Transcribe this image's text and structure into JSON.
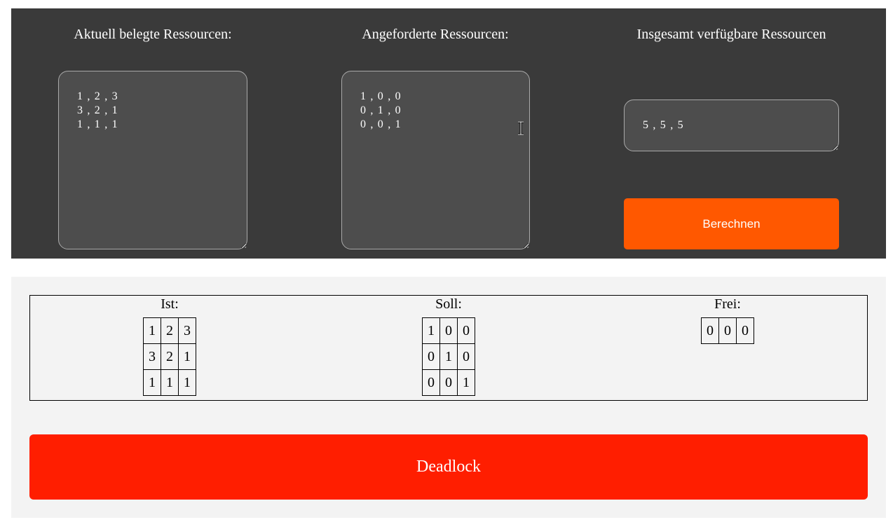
{
  "input_panel": {
    "allocated": {
      "title": "Aktuell belegte Ressourcen:",
      "value": "1 , 2 , 3\n3 , 2 , 1\n1 , 1 , 1"
    },
    "requested": {
      "title": "Angeforderte Ressourcen:",
      "value": "1 , 0 , 0\n0 , 1 , 0\n0 , 0 , 1"
    },
    "available": {
      "title": "Insgesamt verfügbare Ressourcen",
      "value": "5 , 5 , 5"
    },
    "calculate_label": "Berechnen",
    "colors": {
      "panel_bg": "#3a3a3a",
      "field_bg": "#4d4d4d",
      "button_bg": "#ff5800"
    }
  },
  "results": {
    "ist": {
      "label": "Ist:",
      "rows": [
        [
          "1",
          "2",
          "3"
        ],
        [
          "3",
          "2",
          "1"
        ],
        [
          "1",
          "1",
          "1"
        ]
      ]
    },
    "soll": {
      "label": "Soll:",
      "rows": [
        [
          "1",
          "0",
          "0"
        ],
        [
          "0",
          "1",
          "0"
        ],
        [
          "0",
          "0",
          "1"
        ]
      ]
    },
    "frei": {
      "label": "Frei:",
      "rows": [
        [
          "0",
          "0",
          "0"
        ]
      ]
    },
    "status": "Deadlock",
    "colors": {
      "panel_bg": "#f3f3f3",
      "status_bg": "#ff1e00"
    }
  },
  "icons": {
    "text_cursor": "i-beam-cursor-icon"
  }
}
